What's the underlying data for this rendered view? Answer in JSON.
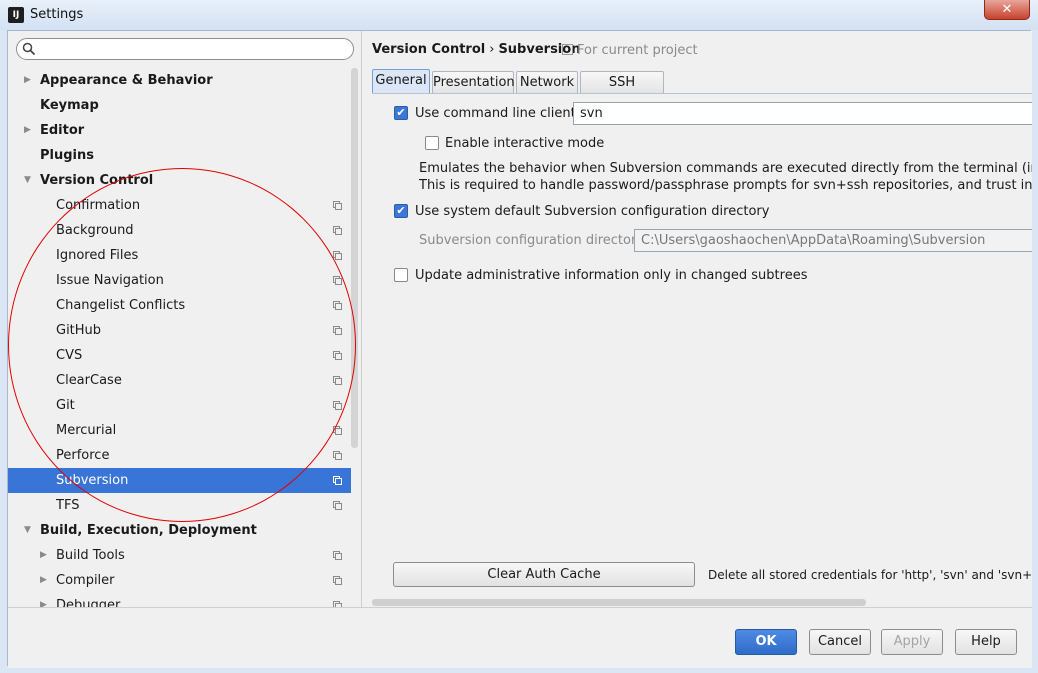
{
  "window": {
    "title": "Settings",
    "app_icon": "IJ",
    "close_glyph": "✕"
  },
  "sidebar": {
    "search": {
      "value": "",
      "placeholder": ""
    },
    "items": [
      {
        "label": "Appearance & Behavior",
        "level": 0,
        "arrow": "▶"
      },
      {
        "label": "Keymap",
        "level": 0,
        "arrow": ""
      },
      {
        "label": "Editor",
        "level": 0,
        "arrow": "▶"
      },
      {
        "label": "Plugins",
        "level": 0,
        "arrow": ""
      },
      {
        "label": "Version Control",
        "level": 0,
        "arrow": "▼"
      },
      {
        "label": "Confirmation",
        "level": 1
      },
      {
        "label": "Background",
        "level": 1
      },
      {
        "label": "Ignored Files",
        "level": 1
      },
      {
        "label": "Issue Navigation",
        "level": 1
      },
      {
        "label": "Changelist Conflicts",
        "level": 1
      },
      {
        "label": "GitHub",
        "level": 1
      },
      {
        "label": "CVS",
        "level": 1
      },
      {
        "label": "ClearCase",
        "level": 1
      },
      {
        "label": "Git",
        "level": 1
      },
      {
        "label": "Mercurial",
        "level": 1
      },
      {
        "label": "Perforce",
        "level": 1
      },
      {
        "label": "Subversion",
        "level": 1,
        "selected": true
      },
      {
        "label": "TFS",
        "level": 1
      },
      {
        "label": "Build, Execution, Deployment",
        "level": 0,
        "arrow": "▼"
      },
      {
        "label": "Build Tools",
        "level": 1,
        "arrow": "▶"
      },
      {
        "label": "Compiler",
        "level": 1,
        "arrow": "▶"
      },
      {
        "label": "Debugger",
        "level": 1,
        "arrow": "▶"
      }
    ]
  },
  "content": {
    "breadcrumb": {
      "parent": "Version Control",
      "separator": "›",
      "current": "Subversion"
    },
    "scope_label": "For current project",
    "tabs": [
      {
        "label": "General",
        "active": true
      },
      {
        "label": "Presentation"
      },
      {
        "label": "Network"
      },
      {
        "label": "SSH Settings"
      }
    ],
    "general": {
      "use_cmd_client": {
        "label": "Use command line client:",
        "checked": true,
        "value": "svn"
      },
      "interactive_mode": {
        "label": "Enable interactive mode",
        "checked": false
      },
      "description_line1": "Emulates the behavior when Subversion commands are executed directly from the terminal (in the interacti",
      "description_line2": "This is required to handle password/passphrase prompts for svn+ssh repositories, and trust invalid server",
      "use_default_config": {
        "label": "Use system default Subversion configuration directory",
        "checked": true
      },
      "config_dir": {
        "label": "Subversion configuration directory:",
        "value": "C:\\Users\\gaoshaochen\\AppData\\Roaming\\Subversion"
      },
      "update_admin": {
        "label": "Update administrative information only in changed subtrees",
        "checked": false
      },
      "clear_cache_button": "Clear Auth Cache",
      "clear_cache_hint": "Delete all stored credentials for 'http', 'svn' and 'svn+ssh' proto"
    }
  },
  "footer": {
    "ok": "OK",
    "cancel": "Cancel",
    "apply": "Apply",
    "help": "Help"
  },
  "colors": {
    "selection": "#3875d7",
    "annotation": "#e00000",
    "primary_button": "#2f6cc9"
  },
  "checkmark_glyph": "✔"
}
